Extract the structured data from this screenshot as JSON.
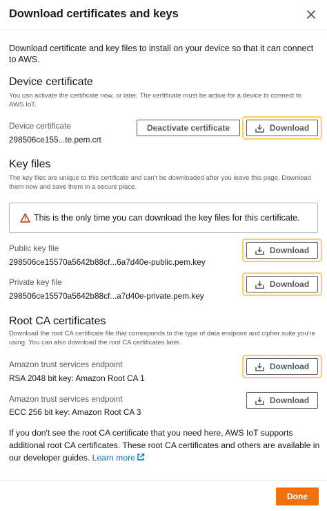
{
  "dialog": {
    "title": "Download certificates and keys",
    "intro": "Download certificate and key files to install on your device so that it can connect to AWS."
  },
  "device_certificate": {
    "heading": "Device certificate",
    "description": "You can activate the certificate now, or later. The certificate must be active for a device to connect to AWS IoT.",
    "label": "Device certificate",
    "file": "298506ce155...te.pem.crt",
    "deactivate_label": "Deactivate certificate",
    "download_label": "Download"
  },
  "key_files": {
    "heading": "Key files",
    "description": "The key files are unique to this certificate and can't be downloaded after you leave this page. Download them now and save them in a secure place.",
    "alert": "This is the only time you can download the key files for this certificate.",
    "public": {
      "label": "Public key file",
      "file": "298506ce15570a5642b88cf...6a7d40e-public.pem.key",
      "download_label": "Download"
    },
    "private": {
      "label": "Private key file",
      "file": "298506ce15570a5642b88cf...a7d40e-private.pem.key",
      "download_label": "Download"
    }
  },
  "root_ca": {
    "heading": "Root CA certificates",
    "description": "Download the root CA certificate file that corresponds to the type of data endpoint and cipher suite you're using. You can also download the root CA certificates later.",
    "items": [
      {
        "label": "Amazon trust services endpoint",
        "file": "RSA 2048 bit key: Amazon Root CA 1",
        "download_label": "Download"
      },
      {
        "label": "Amazon trust services endpoint",
        "file": "ECC 256 bit key: Amazon Root CA 3",
        "download_label": "Download"
      }
    ]
  },
  "footer": {
    "text": "If you don't see the root CA certificate that you need here, AWS IoT supports additional root CA certificates. These root CA certificates and others are available in our developer guides.",
    "link_label": "Learn more",
    "done_label": "Done"
  },
  "colors": {
    "primary_button": "#ec7211",
    "link": "#0073bb",
    "highlight": "#f4d36b",
    "warning": "#d13212"
  },
  "icons": [
    "close-icon",
    "download-icon",
    "warning-icon",
    "external-link-icon"
  ]
}
